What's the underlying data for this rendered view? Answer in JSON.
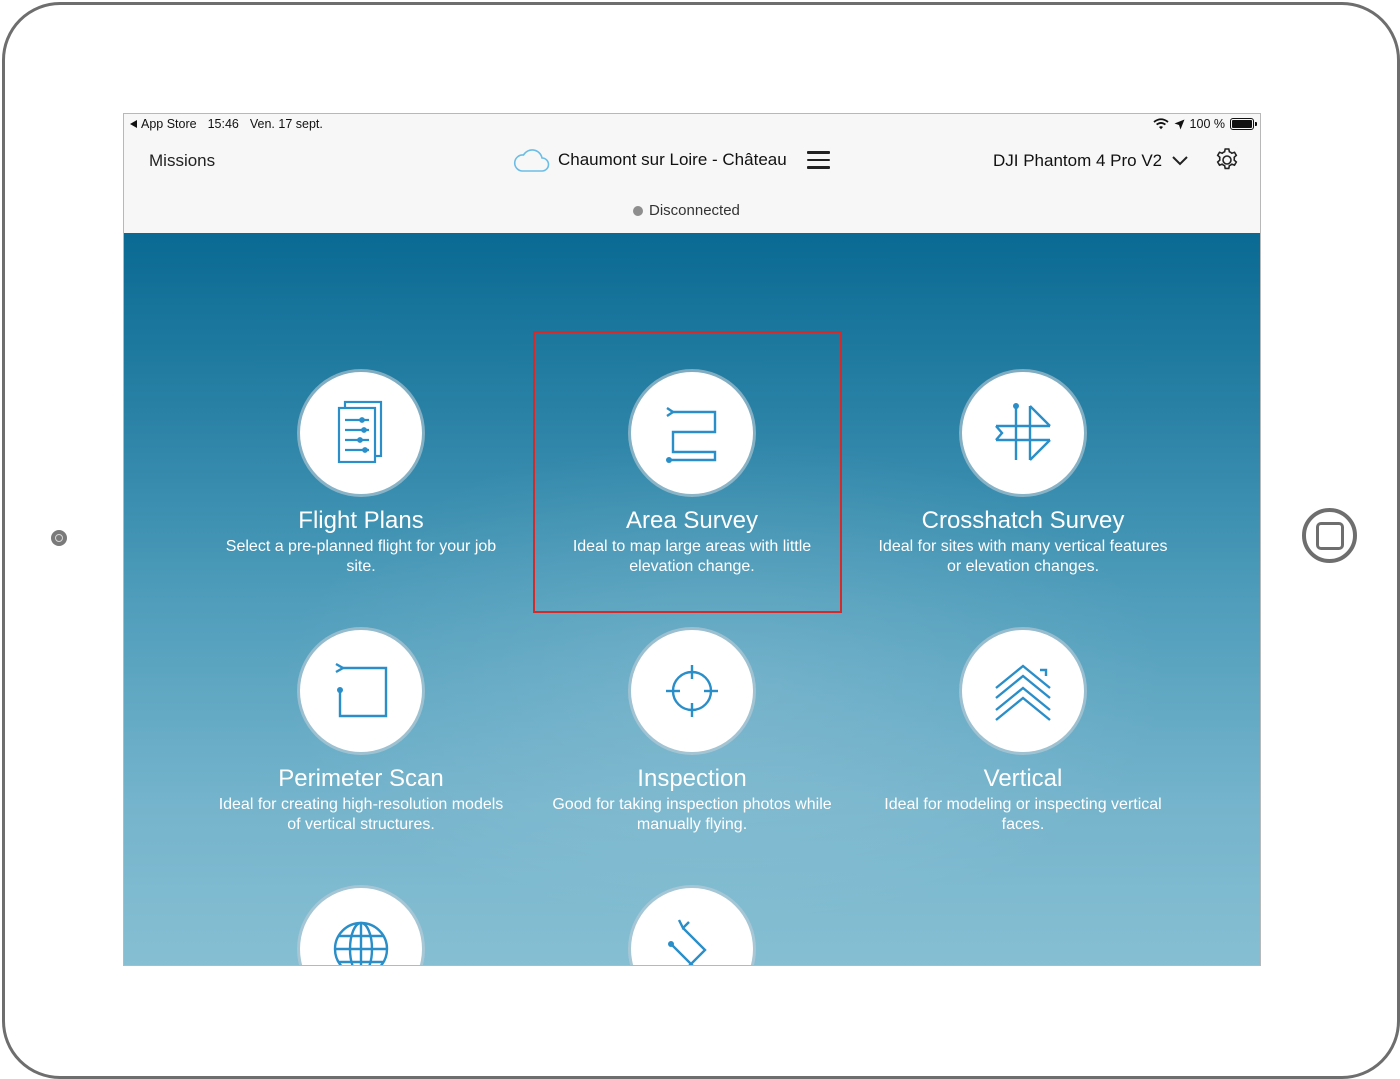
{
  "status_bar": {
    "back_app": "App Store",
    "time": "15:46",
    "date": "Ven. 17 sept.",
    "battery": "100 %"
  },
  "header": {
    "missions_label": "Missions",
    "site_name": "Chaumont sur Loire - Château",
    "drone_name": "DJI Phantom 4 Pro V2",
    "connection_status": "Disconnected"
  },
  "tiles": [
    {
      "title": "Flight Plans",
      "desc": "Select a pre-planned flight for your job site.",
      "icon": "documents-icon"
    },
    {
      "title": "Area Survey",
      "desc": "Ideal to map large areas with little elevation change.",
      "icon": "area-survey-path-icon"
    },
    {
      "title": "Crosshatch Survey",
      "desc": "Ideal for sites with many vertical features or elevation changes.",
      "icon": "crosshatch-grid-icon"
    },
    {
      "title": "Perimeter Scan",
      "desc": "Ideal for creating high-resolution models of vertical structures.",
      "icon": "perimeter-square-icon"
    },
    {
      "title": "Inspection",
      "desc": "Good for taking inspection photos while manually flying.",
      "icon": "crosshair-target-icon"
    },
    {
      "title": "Vertical",
      "desc": "Ideal for modeling or inspecting vertical faces.",
      "icon": "vertical-chevrons-icon"
    },
    {
      "title": "",
      "desc": "",
      "icon": "globe-icon"
    },
    {
      "title": "",
      "desc": "",
      "icon": "zigzag-path-icon"
    }
  ],
  "colors": {
    "icon_blue": "#2a8ec8",
    "highlight_red": "#d42a2a",
    "sky_top": "#0a6a93",
    "sky_bottom": "#86bfd3"
  }
}
